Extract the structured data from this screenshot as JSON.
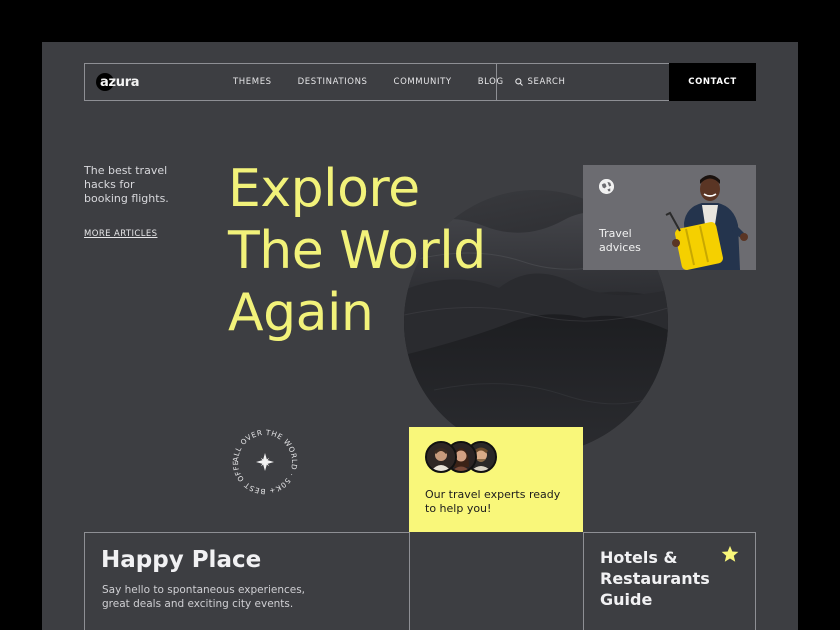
{
  "brand": {
    "name": "azura"
  },
  "nav": {
    "links": [
      "THEMES",
      "DESTINATIONS",
      "COMMUNITY",
      "BLOG"
    ],
    "search_label": "SEARCH",
    "contact_label": "CONTACT"
  },
  "sidebar": {
    "blurb": "The best travel hacks for booking flights.",
    "more_link": "MORE ARTICLES"
  },
  "hero": {
    "line1": "Explore",
    "line2": "The World",
    "line3": "Again"
  },
  "travel_card": {
    "label": "Travel advices",
    "icon": "globe-icon"
  },
  "badge": {
    "text": "ALL OVER THE WORLD · 50K+ BEST OFFERS ·",
    "icon": "compass-star-icon"
  },
  "experts_card": {
    "text": "Our travel experts ready to help you!"
  },
  "happy_card": {
    "title": "Happy Place",
    "text": "Say hello to spontaneous experiences, great deals and exciting city events."
  },
  "hotels_card": {
    "title": "Hotels & Restaurants Guide",
    "icon": "star-icon"
  },
  "colors": {
    "accent": "#f9f77a",
    "background": "#3d3e42",
    "hero_text": "#f2f27a"
  }
}
